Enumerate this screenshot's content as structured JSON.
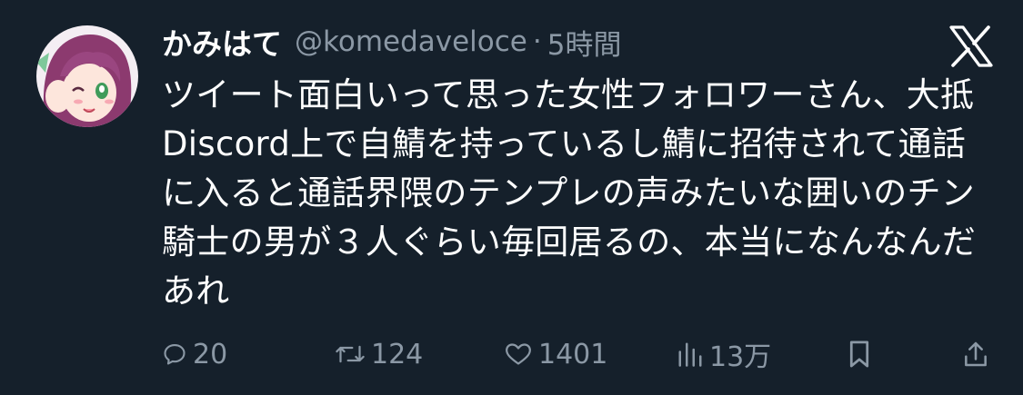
{
  "tweet": {
    "display_name": "かみはて",
    "handle": "@komedaveloce",
    "separator": "·",
    "time": "5時間",
    "text": "ツイート面白いって思った女性フォロワーさん、大抵Discord上で自鯖を持っているし鯖に招待されて通話に入ると通話界隈のテンプレの声みたいな囲いのチン騎士の男が３人ぐらい毎回居るの、本当になんなんだあれ"
  },
  "actions": {
    "reply": {
      "icon": "reply-icon",
      "count": "20"
    },
    "retweet": {
      "icon": "retweet-icon",
      "count": "124"
    },
    "like": {
      "icon": "heart-icon",
      "count": "1401"
    },
    "views": {
      "icon": "views-icon",
      "count": "13万"
    },
    "bookmark": {
      "icon": "bookmark-icon"
    },
    "share": {
      "icon": "share-icon"
    }
  },
  "colors": {
    "background": "#15202b",
    "text": "#ffffff",
    "secondary": "#8b98a5"
  }
}
